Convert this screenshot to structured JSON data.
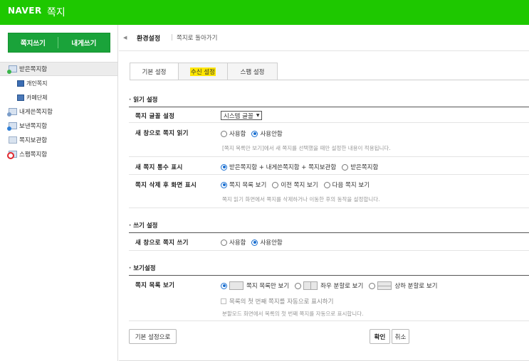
{
  "app": {
    "brand": "NAVER",
    "title": "쪽지"
  },
  "sidebar": {
    "compose_label": "쪽지쓰기",
    "self_compose_label": "내게쓰기",
    "items": [
      {
        "label": "받은쪽지함",
        "icon": "inbox-icon",
        "active": true
      },
      {
        "label": "개인쪽지",
        "icon": "person-icon"
      },
      {
        "label": "카페단체",
        "icon": "group-icon"
      },
      {
        "label": "내게쓴쪽지함",
        "icon": "self-mailbox-icon"
      },
      {
        "label": "보낸쪽지함",
        "icon": "sent-mailbox-icon"
      },
      {
        "label": "쪽지보관함",
        "icon": "folder-icon"
      },
      {
        "label": "스팸쪽지함",
        "icon": "spam-icon"
      }
    ]
  },
  "header": {
    "title": "환경설정",
    "back_link": "쪽지로 돌아가기"
  },
  "tabs": [
    {
      "label": "기본 설정",
      "active": true
    },
    {
      "label": "수신 설정",
      "highlight_color": "#ffe600"
    },
    {
      "label": "스팸 설정"
    }
  ],
  "read_settings": {
    "title": "읽기 설정",
    "font": {
      "label": "쪽지 글꼴 설정",
      "value": "시스템 글꼴"
    },
    "new_window": {
      "label": "새 창으로 쪽지 읽기",
      "options": [
        "사용함",
        "사용안함"
      ],
      "selected": "사용안함",
      "note": "[쪽지 목록만 보기]에서 새 쪽지를 선택했을 때만 설정한 내용이 적용됩니다."
    },
    "new_count": {
      "label": "새 쪽지 통수 표시",
      "options": [
        "받은쪽지함 + 내게쓴쪽지함 + 쪽지보관함",
        "받은쪽지함"
      ],
      "selected": "받은쪽지함 + 내게쓴쪽지함 + 쪽지보관함"
    },
    "after_delete": {
      "label": "쪽지 삭제 후 화면 표시",
      "options": [
        "쪽지 목록 보기",
        "이전 쪽지 보기",
        "다음 쪽지 보기"
      ],
      "selected": "쪽지 목록 보기",
      "note": "쪽지 읽기 화면에서 쪽지를 삭제하거나 이동한 후의 동작을 설정합니다."
    }
  },
  "write_settings": {
    "title": "쓰기 설정",
    "new_window": {
      "label": "새 창으로 쪽지 쓰기",
      "options": [
        "사용함",
        "사용안함"
      ],
      "selected": "사용안함"
    }
  },
  "view_settings": {
    "title": "보기설정",
    "list_view": {
      "label": "쪽지 목록 보기",
      "options": [
        "쪽지 목록만 보기",
        "좌우 분할로 보기",
        "상하 분할로 보기"
      ],
      "selected": "쪽지 목록만 보기",
      "checkbox_label": "목록의 첫 번째 쪽지를 자동으로 표시하기",
      "checkbox_checked": false,
      "note": "분할모드 화면에서 목록의 첫 번째 쪽지를 자동으로 표시합니다."
    }
  },
  "buttons": {
    "reset": "기본 설정으로",
    "confirm": "확인",
    "cancel": "취소"
  },
  "colors": {
    "naver_green": "#1ec800",
    "compose_green": "#1aa33a",
    "radio_blue": "#1a6fd1"
  }
}
